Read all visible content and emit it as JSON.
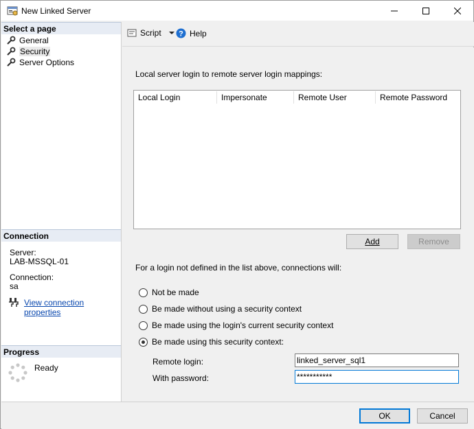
{
  "window": {
    "title": "New Linked Server"
  },
  "left_pane": {
    "select_page_header": "Select a page",
    "pages": [
      {
        "label": "General"
      },
      {
        "label": "Security"
      },
      {
        "label": "Server Options"
      }
    ],
    "connection_header": "Connection",
    "server_label": "Server:",
    "server_value": "LAB-MSSQL-01",
    "connection_label": "Connection:",
    "connection_value": "sa",
    "view_connection_link": "View connection properties",
    "progress_header": "Progress",
    "progress_status": "Ready"
  },
  "toolbar": {
    "script_label": "Script",
    "help_label": "Help"
  },
  "security": {
    "mapping_label": "Local server login to remote server login mappings:",
    "grid_columns": [
      "Local Login",
      "Impersonate",
      "Remote User",
      "Remote Password"
    ],
    "add_button": "Add",
    "remove_button": "Remove",
    "fallback_label": "For a login not defined in the list above, connections will:",
    "options": [
      {
        "label": "Not be made",
        "checked": false
      },
      {
        "label": "Be made without using a security context",
        "checked": false
      },
      {
        "label": "Be made using the login's current security context",
        "checked": false
      },
      {
        "label": "Be made using this security context:",
        "checked": true
      }
    ],
    "remote_login_label": "Remote login:",
    "remote_login_value": "linked_server_sql1",
    "password_label": "With password:",
    "password_value": "***********"
  },
  "footer": {
    "ok_button": "OK",
    "cancel_button": "Cancel"
  },
  "colors": {
    "section_header_bg": "#e7ecf4",
    "link": "#0645ad",
    "focus_border": "#0078d7"
  }
}
